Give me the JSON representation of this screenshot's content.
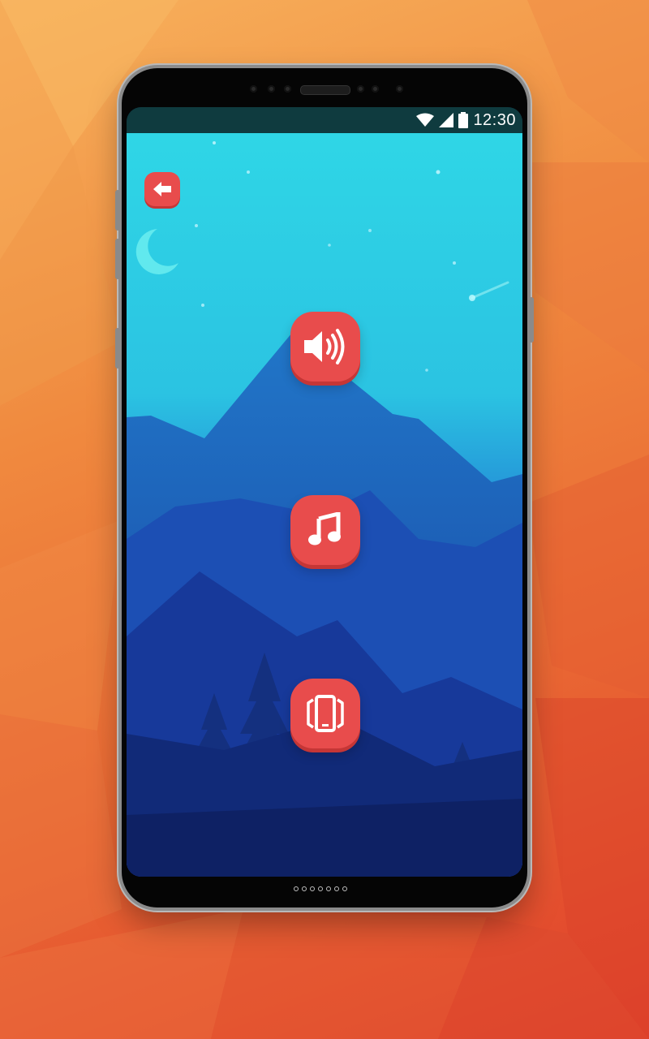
{
  "status_bar": {
    "time": "12:30",
    "icons": [
      "wifi-icon",
      "cellular-signal-icon",
      "battery-icon"
    ]
  },
  "screen": {
    "back_button": {
      "icon": "back-arrow-icon"
    },
    "buttons": [
      {
        "name": "volume-button",
        "icon": "speaker-volume-icon"
      },
      {
        "name": "music-button",
        "icon": "music-note-icon"
      },
      {
        "name": "vibrate-button",
        "icon": "vibrate-phone-icon"
      }
    ]
  },
  "colors": {
    "button_red": "#e84c4c",
    "sky_top": "#2fd6e6",
    "sky_bottom": "#1a4fc0",
    "background_orange": "#ef7a3a"
  }
}
